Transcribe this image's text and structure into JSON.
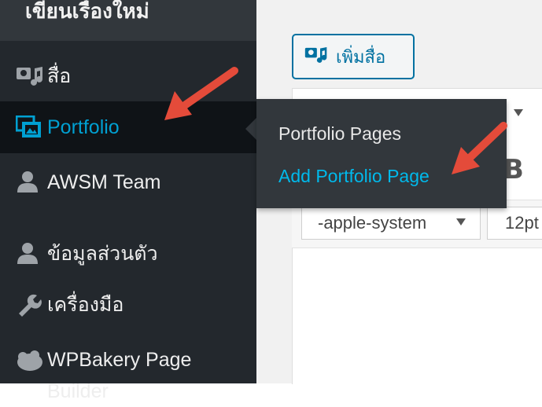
{
  "sidebar": {
    "top_label": "เขียนเรื่องใหม่",
    "items": [
      {
        "label": "สื่อ",
        "icon": "media-icon"
      },
      {
        "label": "Portfolio",
        "icon": "portfolio-icon",
        "active": true
      },
      {
        "label": "AWSM Team",
        "icon": "user-icon"
      },
      {
        "label": "ข้อมูลส่วนตัว",
        "icon": "user-icon"
      },
      {
        "label": "เครื่องมือ",
        "icon": "wrench-icon"
      },
      {
        "label": "WPBakery Page Builder",
        "icon": "wpbakery-icon"
      }
    ]
  },
  "flyout": {
    "items": [
      {
        "label": "Portfolio Pages"
      },
      {
        "label": "Add Portfolio Page"
      }
    ]
  },
  "main": {
    "add_media_label": "เพิ่มสื่อ",
    "font_family_value": "-apple-system",
    "font_size_value": "12pt"
  },
  "colors": {
    "sidebar_bg": "#23282d",
    "active_text": "#00a0d2",
    "flyout_link": "#00b9eb",
    "arrow": "#e44b3a",
    "button_border": "#0071a1"
  }
}
